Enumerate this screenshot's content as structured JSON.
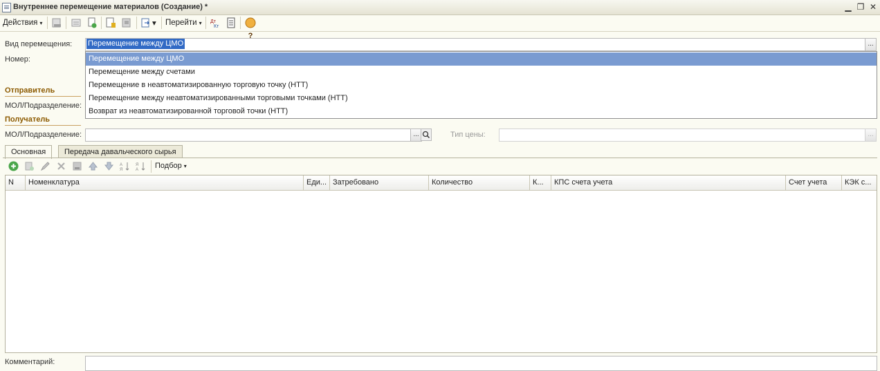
{
  "window": {
    "title": "Внутреннее перемещение материалов (Создание) *",
    "min": "▁",
    "restore": "❐",
    "close": "✕"
  },
  "toolbar": {
    "actions_label": "Действия",
    "goto_label": "Перейти",
    "caret": "▾",
    "help_glyph": "?"
  },
  "form": {
    "transfer_type_label": "Вид перемещения:",
    "transfer_type_value": "Перемещение между ЦМО",
    "number_label": "Номер:",
    "sender_section": "Отправитель",
    "sender_mol_label": "МОЛ/Подразделение:",
    "receiver_section": "Получатель",
    "receiver_mol_label": "МОЛ/Подразделение:",
    "price_type_label": "Тип цены:",
    "ellipsis": "...",
    "comment_label": "Комментарий:"
  },
  "dropdown": {
    "options": [
      "Перемещение между ЦМО",
      "Перемещение между счетами",
      "Перемещение в неавтоматизированную торговую точку (НТТ)",
      "Перемещение между неавтоматизированными торговыми точками (НТТ)",
      "Возврат из неавтоматизированной торговой точки (НТТ)"
    ],
    "selected_index": 0
  },
  "tabs": [
    {
      "label": "Основная",
      "active": true
    },
    {
      "label": "Передача давальческого сырья",
      "active": false
    }
  ],
  "table_toolbar": {
    "pick_label": "Подбор"
  },
  "table": {
    "columns": [
      "N",
      "Номенклатура",
      "Еди...",
      "Затребовано",
      "Количество",
      "К...",
      "КПС счета учета",
      "Счет учета",
      "КЭК с..."
    ],
    "rows": []
  },
  "colors": {
    "section": "#8c5a00",
    "selection": "#316ac5",
    "dropdown_selected": "#7a9bd1",
    "background": "#fbfbf2"
  }
}
